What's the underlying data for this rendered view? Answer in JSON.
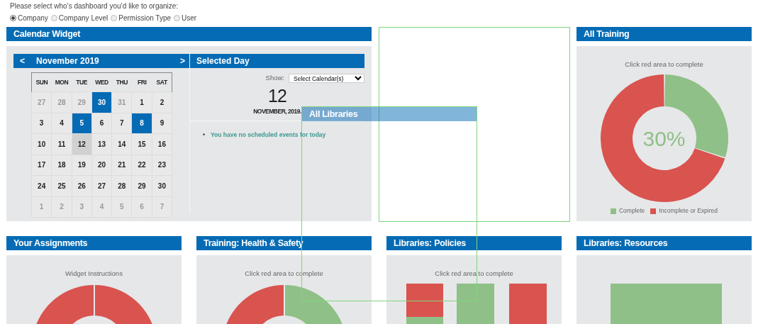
{
  "prompt": "Please select who’s dashboard you’d like to organize:",
  "scope_options": [
    {
      "label": "Company",
      "selected": true
    },
    {
      "label": "Company Level",
      "selected": false
    },
    {
      "label": "Permission Type",
      "selected": false
    },
    {
      "label": "User",
      "selected": false
    }
  ],
  "widgets": [
    {
      "kind": "calendar",
      "title": "Calendar Widget",
      "calendar": {
        "prev": "<",
        "month_label": "November 2019",
        "next": ">",
        "weekdays": [
          "SUN",
          "MON",
          "TUE",
          "WED",
          "THU",
          "FRI",
          "SAT"
        ],
        "weeks": [
          [
            {
              "day": "27",
              "outside": true,
              "highlighted": false,
              "selected": false
            },
            {
              "day": "28",
              "outside": true,
              "highlighted": false,
              "selected": false
            },
            {
              "day": "29",
              "outside": true,
              "highlighted": false,
              "selected": false
            },
            {
              "day": "30",
              "outside": true,
              "highlighted": true,
              "selected": false
            },
            {
              "day": "31",
              "outside": true,
              "highlighted": false,
              "selected": false
            },
            {
              "day": "1",
              "outside": false,
              "highlighted": false,
              "selected": false
            },
            {
              "day": "2",
              "outside": false,
              "highlighted": false,
              "selected": false
            }
          ],
          [
            {
              "day": "3",
              "outside": false,
              "highlighted": false,
              "selected": false
            },
            {
              "day": "4",
              "outside": false,
              "highlighted": false,
              "selected": false
            },
            {
              "day": "5",
              "outside": false,
              "highlighted": true,
              "selected": false
            },
            {
              "day": "6",
              "outside": false,
              "highlighted": false,
              "selected": false
            },
            {
              "day": "7",
              "outside": false,
              "highlighted": false,
              "selected": false
            },
            {
              "day": "8",
              "outside": false,
              "highlighted": true,
              "selected": false
            },
            {
              "day": "9",
              "outside": false,
              "highlighted": false,
              "selected": false
            }
          ],
          [
            {
              "day": "10",
              "outside": false,
              "highlighted": false,
              "selected": false
            },
            {
              "day": "11",
              "outside": false,
              "highlighted": false,
              "selected": false
            },
            {
              "day": "12",
              "outside": false,
              "highlighted": false,
              "selected": true
            },
            {
              "day": "13",
              "outside": false,
              "highlighted": false,
              "selected": false
            },
            {
              "day": "14",
              "outside": false,
              "highlighted": false,
              "selected": false
            },
            {
              "day": "15",
              "outside": false,
              "highlighted": false,
              "selected": false
            },
            {
              "day": "16",
              "outside": false,
              "highlighted": false,
              "selected": false
            }
          ],
          [
            {
              "day": "17",
              "outside": false,
              "highlighted": false,
              "selected": false
            },
            {
              "day": "18",
              "outside": false,
              "highlighted": false,
              "selected": false
            },
            {
              "day": "19",
              "outside": false,
              "highlighted": false,
              "selected": false
            },
            {
              "day": "20",
              "outside": false,
              "highlighted": false,
              "selected": false
            },
            {
              "day": "21",
              "outside": false,
              "highlighted": false,
              "selected": false
            },
            {
              "day": "22",
              "outside": false,
              "highlighted": false,
              "selected": false
            },
            {
              "day": "23",
              "outside": false,
              "highlighted": false,
              "selected": false
            }
          ],
          [
            {
              "day": "24",
              "outside": false,
              "highlighted": false,
              "selected": false
            },
            {
              "day": "25",
              "outside": false,
              "highlighted": false,
              "selected": false
            },
            {
              "day": "26",
              "outside": false,
              "highlighted": false,
              "selected": false
            },
            {
              "day": "27",
              "outside": false,
              "highlighted": false,
              "selected": false
            },
            {
              "day": "28",
              "outside": false,
              "highlighted": false,
              "selected": false
            },
            {
              "day": "29",
              "outside": false,
              "highlighted": false,
              "selected": false
            },
            {
              "day": "30",
              "outside": false,
              "highlighted": false,
              "selected": false
            }
          ],
          [
            {
              "day": "1",
              "outside": true,
              "highlighted": false,
              "selected": false
            },
            {
              "day": "2",
              "outside": true,
              "highlighted": false,
              "selected": false
            },
            {
              "day": "3",
              "outside": true,
              "highlighted": false,
              "selected": false
            },
            {
              "day": "4",
              "outside": true,
              "highlighted": false,
              "selected": false
            },
            {
              "day": "5",
              "outside": true,
              "highlighted": false,
              "selected": false
            },
            {
              "day": "6",
              "outside": true,
              "highlighted": false,
              "selected": false
            },
            {
              "day": "7",
              "outside": true,
              "highlighted": false,
              "selected": false
            }
          ]
        ]
      },
      "selected_day": {
        "title": "Selected Day",
        "show_label": "Show:",
        "calendar_select": "Select Calendar(s)",
        "day": "12",
        "date": "NOVEMBER, 2019.",
        "events": [
          {
            "marker": "•",
            "text": "You have no scheduled events for today"
          }
        ]
      }
    },
    {
      "kind": "placeholder"
    },
    {
      "kind": "donut",
      "title": "All Training",
      "caption": "Click red area to complete",
      "center_label": "30%",
      "chart_data": {
        "type": "donut",
        "categories": [
          "Complete",
          "Incomplete or Expired"
        ],
        "values": [
          30,
          70
        ],
        "colors": [
          "#8fc087",
          "#d9534f"
        ]
      }
    },
    {
      "kind": "half_donut",
      "title": "Your Assignments",
      "caption": "Widget Instructions",
      "slices": [
        {
          "color": "#d9534f"
        },
        {
          "color": "#d9534f"
        }
      ]
    },
    {
      "kind": "half_donut",
      "title": "Training: Health & Safety",
      "caption": "Click red area to complete",
      "slices": [
        {
          "color": "#d9534f"
        },
        {
          "color": "#8fc087"
        }
      ]
    },
    {
      "kind": "bars",
      "title": "Libraries: Policies",
      "caption": "Click red area to complete"
    },
    {
      "kind": "wide_bar",
      "title": "Libraries: Resources"
    }
  ],
  "dragged_widget": {
    "title": "All Libraries"
  }
}
